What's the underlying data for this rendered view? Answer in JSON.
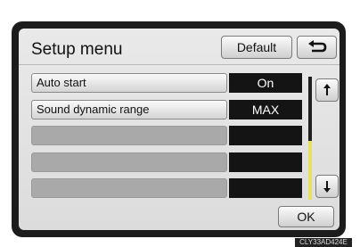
{
  "header": {
    "title": "Setup menu",
    "default_label": "Default",
    "back_icon": "return-arrow-icon"
  },
  "rows": [
    {
      "label": "Auto start",
      "value": "On"
    },
    {
      "label": "Sound dynamic range",
      "value": "MAX"
    },
    {
      "label": "",
      "value": ""
    },
    {
      "label": "",
      "value": ""
    },
    {
      "label": "",
      "value": ""
    }
  ],
  "scrollbar": {
    "up_icon": "scroll-up-icon",
    "down_icon": "scroll-down-icon",
    "thumb_start": 0.52,
    "thumb_end": 1.0,
    "thumb_color": "#e8e060"
  },
  "footer": {
    "ok_label": "OK",
    "image_code": "CLY33AD424E"
  }
}
